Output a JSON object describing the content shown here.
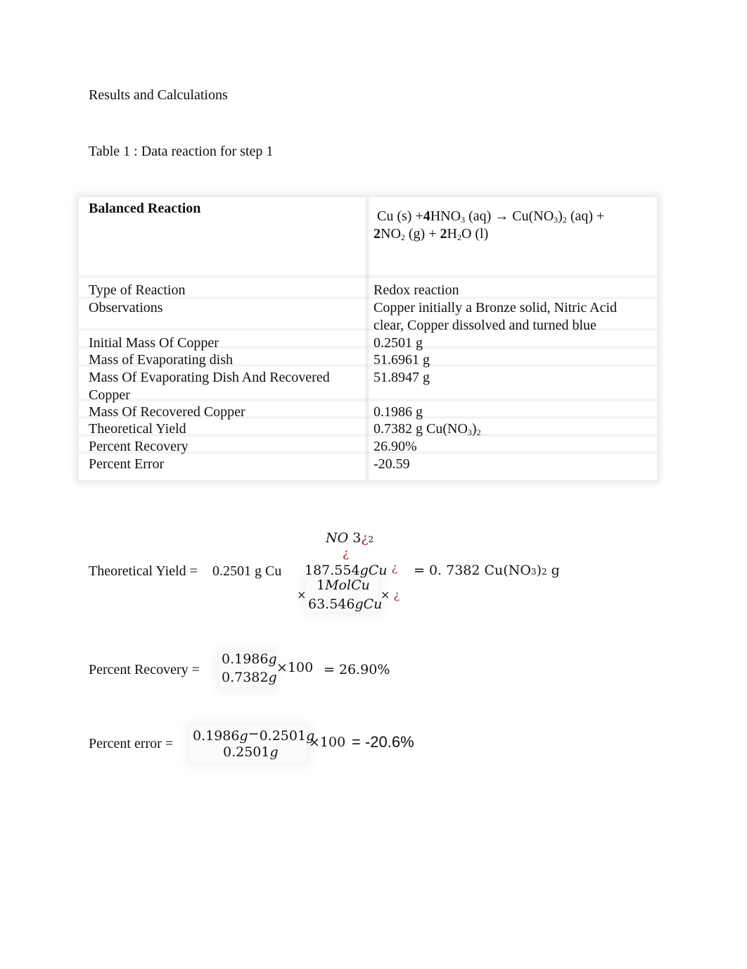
{
  "document": {
    "heading": "Results and Calculations",
    "table_caption": "Table 1 : Data  reaction for step 1"
  },
  "table": {
    "rows": [
      {
        "label": "Balanced Reaction",
        "value": "Cu (s) +4HNO3(aq) → Cu(NO3)2 (aq) + 2NO2(g) + 2H2O (l)"
      },
      {
        "label": "Type of Reaction",
        "value": "Redox reaction"
      },
      {
        "label": "Observations",
        "value": "Copper initially a  Bronze solid, Nitric Acid clear, Copper dissolved and turned blue"
      },
      {
        "label": "Initial Mass Of Copper",
        "value": "0.2501 g"
      },
      {
        "label": "Mass of Evaporating dish",
        "value": "51.6961 g"
      },
      {
        "label": "Mass Of Evaporating Dish And Recovered Copper",
        "value": "51.8947 g"
      },
      {
        "label": "Mass Of Recovered Copper",
        "value": "0.1986 g"
      },
      {
        "label": "Theoretical Yield",
        "value": "0.7382 g Cu(NO3)2"
      },
      {
        "label": "Percent Recovery",
        "value": "26.90%"
      },
      {
        "label": "Percent Error",
        "value": "-20.59"
      }
    ],
    "reaction_parts": {
      "p1": "Cu (s) +",
      "c1": "4",
      "p2": "HNO",
      "s1": "3",
      "p3": " (aq)  →  Cu(NO",
      "s2": "3",
      "p4": ")",
      "s3": "2",
      "p5": " (aq) +",
      "c2": "2",
      "p6": "NO",
      "s4": "2",
      "p7": " (g) + ",
      "c3": "2",
      "p8": "H",
      "s5": "2",
      "p9": "O (l)"
    },
    "theoretical_yield_parts": {
      "main": "0.7382 g Cu(NO",
      "s1": "3",
      "close": ")",
      "s2": "2"
    }
  },
  "equations": {
    "theoretical_yield": {
      "label": "Theoretical Yield =",
      "given": "0.2501 g Cu",
      "top_no": "NO",
      "top_3": "3",
      "glitch": "¿",
      "top_sub": "2",
      "molar_mass_num": "187.554",
      "molar_mass_unit": "gCu",
      "times": "×",
      "mol_num": "1",
      "mol_unit": "MolCu",
      "cu_mass_num": "63.546",
      "cu_mass_unit": "gCu",
      "result_prefix": "= 0. 7382 Cu(NO",
      "result_sub3": "3",
      "result_close": ")",
      "result_sub2": "2",
      "result_suffix": " g"
    },
    "percent_recovery": {
      "label": "Percent Recovery =",
      "numerator": "0.1986",
      "denominator": "0.7382",
      "unit": "g",
      "multiplier": "×100",
      "result": "= 26.90%"
    },
    "percent_error": {
      "label": "Percent error =",
      "numerator_a": "0.1986",
      "minus": "−",
      "numerator_b": "0.2501",
      "denominator": "0.2501",
      "unit": "g",
      "multiplier": "×100",
      "result": "= -20.6%"
    }
  }
}
